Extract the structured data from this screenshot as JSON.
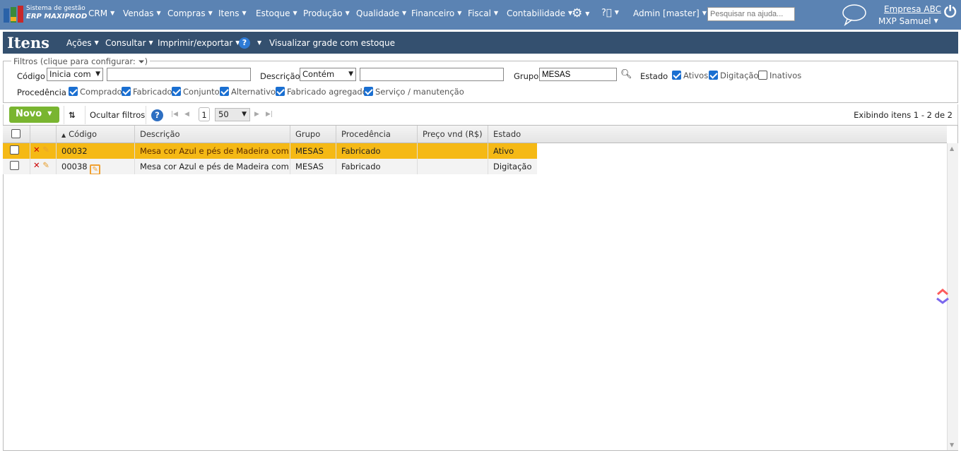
{
  "brand": {
    "line1": "Sistema de gestão",
    "line2": "ERP MAXIPROD"
  },
  "nav": [
    "CRM",
    "Vendas",
    "Compras",
    "Itens",
    "Estoque",
    "Produção",
    "Qualidade",
    "Financeiro",
    "Fiscal",
    "Contabilidade"
  ],
  "user_menu": "Admin [master]",
  "help_search_placeholder": "Pesquisar na ajuda...",
  "company": "Empresa ABC",
  "user": "MXP Samuel",
  "page": {
    "title": "Itens",
    "menu": [
      "Ações",
      "Consultar",
      "Imprimir/exportar"
    ],
    "grid_link": "Visualizar grade com estoque"
  },
  "filters": {
    "legend": "Filtros (clique para configurar:",
    "codigo_label": "Código",
    "codigo_op": "Inicia com",
    "codigo_value": "",
    "descricao_label": "Descrição",
    "descricao_op": "Contém",
    "descricao_value": "",
    "grupo_label": "Grupo",
    "grupo_value": "MESAS",
    "estado_label": "Estado",
    "estado": [
      {
        "label": "Ativos",
        "checked": true
      },
      {
        "label": "Digitação",
        "checked": true
      },
      {
        "label": "Inativos",
        "checked": false
      }
    ],
    "procedencia_label": "Procedência",
    "procedencia": [
      {
        "label": "Comprado",
        "checked": true
      },
      {
        "label": "Fabricado",
        "checked": true
      },
      {
        "label": "Conjunto",
        "checked": true
      },
      {
        "label": "Alternativo",
        "checked": true
      },
      {
        "label": "Fabricado agregado",
        "checked": true
      },
      {
        "label": "Serviço / manutenção",
        "checked": true
      }
    ]
  },
  "toolbar": {
    "new": "Novo",
    "hide_filters": "Ocultar filtros",
    "page": "1",
    "page_size": "50",
    "summary": "Exibindo itens 1 - 2 de 2"
  },
  "columns": [
    "Código",
    "Descrição",
    "Grupo",
    "Procedência",
    "Preço vnd (R$)",
    "Estado"
  ],
  "rows": [
    {
      "codigo": "00032",
      "descricao": "Mesa cor Azul e pés de Madeira com...",
      "grupo": "MESAS",
      "procedencia": "Fabricado",
      "preco": "",
      "estado": "Ativo"
    },
    {
      "codigo": "00038",
      "descricao": "Mesa cor Azul e pés de Madeira com...",
      "grupo": "MESAS",
      "procedencia": "Fabricado",
      "preco": "",
      "estado": "Digitação"
    }
  ],
  "colors": {
    "topbar": "#5b83b3",
    "titlebar": "#34506f",
    "selected_row": "#f5b915",
    "new_button": "#79b530"
  }
}
